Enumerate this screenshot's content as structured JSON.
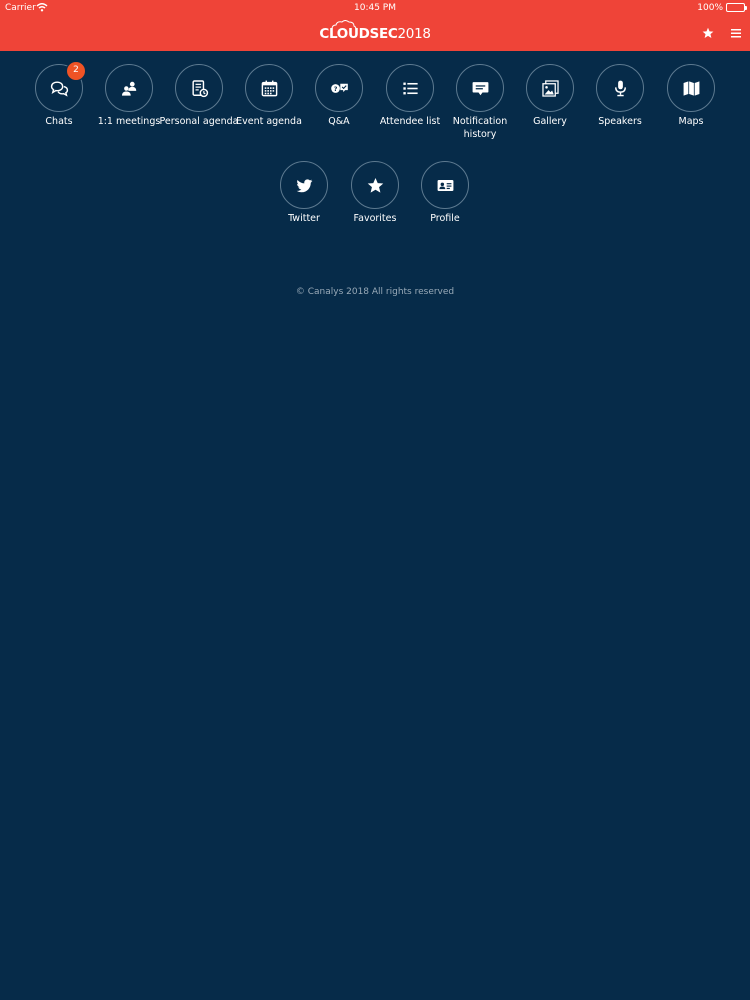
{
  "status_bar": {
    "carrier": "Carrier",
    "time": "10:45 PM",
    "battery": "100%"
  },
  "header": {
    "logo_brand": "CLOUDSEC",
    "logo_year": "2018"
  },
  "menu": [
    {
      "label": "Chats",
      "icon": "chat-bubbles-icon",
      "badge": "2"
    },
    {
      "label": "1:1 meetings",
      "icon": "meeting-people-icon"
    },
    {
      "label": "Personal agenda",
      "icon": "notebook-clock-icon"
    },
    {
      "label": "Event agenda",
      "icon": "calendar-icon"
    },
    {
      "label": "Q&A",
      "icon": "question-answer-icon"
    },
    {
      "label": "Attendee list",
      "icon": "list-icon"
    },
    {
      "label": "Notification history",
      "icon": "message-icon"
    },
    {
      "label": "Gallery",
      "icon": "picture-icon"
    },
    {
      "label": "Speakers",
      "icon": "microphone-icon"
    },
    {
      "label": "Maps",
      "icon": "map-icon"
    },
    {
      "label": "Twitter",
      "icon": "twitter-bird-icon"
    },
    {
      "label": "Favorites",
      "icon": "star-icon"
    },
    {
      "label": "Profile",
      "icon": "id-card-icon"
    }
  ],
  "footer": {
    "copyright": "© Canalys 2018 All rights reserved"
  },
  "colors": {
    "header": "#ef4438",
    "background": "#062b49",
    "badge": "#ef5325",
    "tile_border": "#5d7a90"
  }
}
